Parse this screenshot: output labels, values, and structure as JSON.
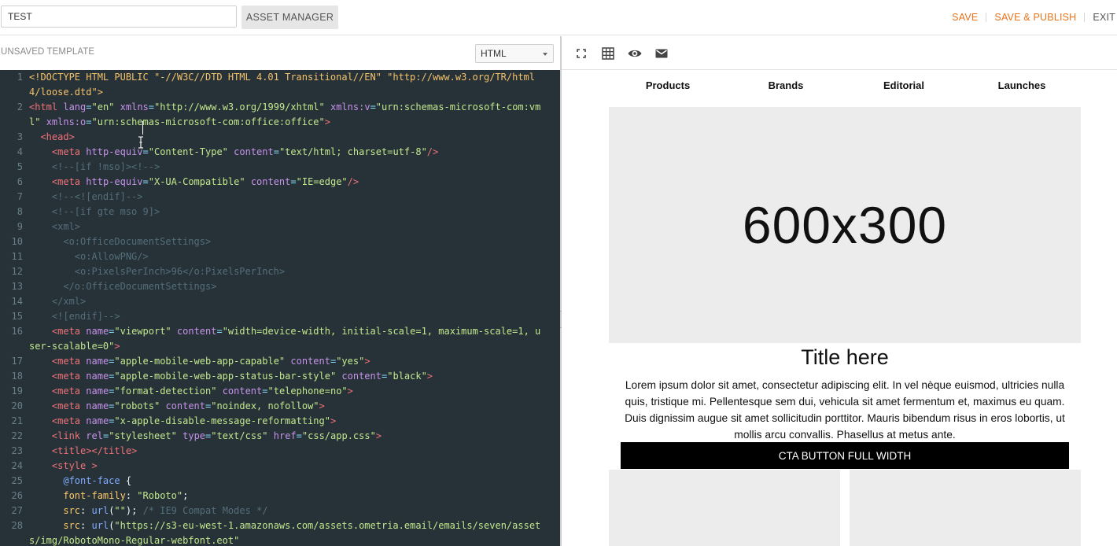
{
  "topbar": {
    "template_name_value": "TEST",
    "asset_manager_label": "ASSET MANAGER",
    "save_label": "SAVE",
    "save_publish_label": "SAVE & PUBLISH",
    "exit_label": "EXIT",
    "accent_color": "#e8731c"
  },
  "editor_header": {
    "status": "UNSAVED TEMPLATE",
    "language_selected": "HTML"
  },
  "preview_toolbar": {
    "icons": [
      "fullscreen-icon",
      "grid-icon",
      "eye-icon",
      "envelope-icon"
    ]
  },
  "code": {
    "background": "#263238",
    "lines": [
      {
        "n": "1",
        "segs": [
          [
            "doc",
            "<!DOCTYPE HTML PUBLIC \"-//W3C//DTD HTML 4.01 Transitional//EN\" \"http://www.w3.org/TR/html4/loose.dtd\">"
          ]
        ]
      },
      {
        "n": "2",
        "segs": [
          [
            "tag",
            "<html "
          ],
          [
            "attr",
            "lang"
          ],
          [
            "eq",
            "="
          ],
          [
            "str",
            "\"en\""
          ],
          [
            "plain",
            " "
          ],
          [
            "attr",
            "xmlns"
          ],
          [
            "eq",
            "="
          ],
          [
            "str",
            "\"http://www.w3.org/1999/xhtml\""
          ],
          [
            "plain",
            " "
          ],
          [
            "attr",
            "xmlns:v"
          ],
          [
            "eq",
            "="
          ],
          [
            "str",
            "\"urn:schemas-microsoft-com:vml\""
          ],
          [
            "plain",
            " "
          ],
          [
            "attr",
            "xmlns:o"
          ],
          [
            "eq",
            "="
          ],
          [
            "str",
            "\"urn:schemas-microsoft-com:office:office\""
          ],
          [
            "tag",
            ">"
          ]
        ]
      },
      {
        "n": "3",
        "segs": [
          [
            "plain",
            "  "
          ],
          [
            "tag",
            "<head>"
          ]
        ]
      },
      {
        "n": "4",
        "segs": [
          [
            "plain",
            "    "
          ],
          [
            "tag",
            "<meta "
          ],
          [
            "attr",
            "http-equiv"
          ],
          [
            "eq",
            "="
          ],
          [
            "str",
            "\"Content-Type\""
          ],
          [
            "plain",
            " "
          ],
          [
            "attr",
            "content"
          ],
          [
            "eq",
            "="
          ],
          [
            "str",
            "\"text/html; charset=utf-8\""
          ],
          [
            "tag",
            "/>"
          ]
        ]
      },
      {
        "n": "5",
        "segs": [
          [
            "plain",
            "    "
          ],
          [
            "cm",
            "<!--[if !mso]><!-->"
          ]
        ]
      },
      {
        "n": "6",
        "segs": [
          [
            "plain",
            "    "
          ],
          [
            "tag",
            "<meta "
          ],
          [
            "attr",
            "http-equiv"
          ],
          [
            "eq",
            "="
          ],
          [
            "str",
            "\"X-UA-Compatible\""
          ],
          [
            "plain",
            " "
          ],
          [
            "attr",
            "content"
          ],
          [
            "eq",
            "="
          ],
          [
            "str",
            "\"IE=edge\""
          ],
          [
            "tag",
            "/>"
          ]
        ]
      },
      {
        "n": "7",
        "segs": [
          [
            "plain",
            "    "
          ],
          [
            "cm",
            "<!--<![endif]-->"
          ]
        ]
      },
      {
        "n": "8",
        "segs": [
          [
            "plain",
            "    "
          ],
          [
            "cm",
            "<!--[if gte mso 9]>"
          ]
        ]
      },
      {
        "n": "9",
        "segs": [
          [
            "plain",
            "    "
          ],
          [
            "cm",
            "<xml>"
          ]
        ]
      },
      {
        "n": "10",
        "segs": [
          [
            "plain",
            "      "
          ],
          [
            "cm",
            "<o:OfficeDocumentSettings>"
          ]
        ]
      },
      {
        "n": "11",
        "segs": [
          [
            "plain",
            "        "
          ],
          [
            "cm",
            "<o:AllowPNG/>"
          ]
        ]
      },
      {
        "n": "12",
        "segs": [
          [
            "plain",
            "        "
          ],
          [
            "cm",
            "<o:PixelsPerInch>96</o:PixelsPerInch>"
          ]
        ]
      },
      {
        "n": "13",
        "segs": [
          [
            "plain",
            "      "
          ],
          [
            "cm",
            "</o:OfficeDocumentSettings>"
          ]
        ]
      },
      {
        "n": "14",
        "segs": [
          [
            "plain",
            "    "
          ],
          [
            "cm",
            "</xml>"
          ]
        ]
      },
      {
        "n": "15",
        "segs": [
          [
            "plain",
            "    "
          ],
          [
            "cm",
            "<![endif]-->"
          ]
        ]
      },
      {
        "n": "16",
        "segs": [
          [
            "plain",
            "    "
          ],
          [
            "tag",
            "<meta "
          ],
          [
            "attr",
            "name"
          ],
          [
            "eq",
            "="
          ],
          [
            "str",
            "\"viewport\""
          ],
          [
            "plain",
            " "
          ],
          [
            "attr",
            "content"
          ],
          [
            "eq",
            "="
          ],
          [
            "str",
            "\"width=device-width, initial-scale=1, maximum-scale=1, user-scalable=0\""
          ],
          [
            "tag",
            ">"
          ]
        ]
      },
      {
        "n": "17",
        "segs": [
          [
            "plain",
            "    "
          ],
          [
            "tag",
            "<meta "
          ],
          [
            "attr",
            "name"
          ],
          [
            "eq",
            "="
          ],
          [
            "str",
            "\"apple-mobile-web-app-capable\""
          ],
          [
            "plain",
            " "
          ],
          [
            "attr",
            "content"
          ],
          [
            "eq",
            "="
          ],
          [
            "str",
            "\"yes\""
          ],
          [
            "tag",
            ">"
          ]
        ]
      },
      {
        "n": "18",
        "segs": [
          [
            "plain",
            "    "
          ],
          [
            "tag",
            "<meta "
          ],
          [
            "attr",
            "name"
          ],
          [
            "eq",
            "="
          ],
          [
            "str",
            "\"apple-mobile-web-app-status-bar-style\""
          ],
          [
            "plain",
            " "
          ],
          [
            "attr",
            "content"
          ],
          [
            "eq",
            "="
          ],
          [
            "str",
            "\"black\""
          ],
          [
            "tag",
            ">"
          ]
        ]
      },
      {
        "n": "19",
        "segs": [
          [
            "plain",
            "    "
          ],
          [
            "tag",
            "<meta "
          ],
          [
            "attr",
            "name"
          ],
          [
            "eq",
            "="
          ],
          [
            "str",
            "\"format-detection\""
          ],
          [
            "plain",
            " "
          ],
          [
            "attr",
            "content"
          ],
          [
            "eq",
            "="
          ],
          [
            "str",
            "\"telephone=no\""
          ],
          [
            "tag",
            ">"
          ]
        ]
      },
      {
        "n": "20",
        "segs": [
          [
            "plain",
            "    "
          ],
          [
            "tag",
            "<meta "
          ],
          [
            "attr",
            "name"
          ],
          [
            "eq",
            "="
          ],
          [
            "str",
            "\"robots\""
          ],
          [
            "plain",
            " "
          ],
          [
            "attr",
            "content"
          ],
          [
            "eq",
            "="
          ],
          [
            "str",
            "\"noindex, nofollow\""
          ],
          [
            "tag",
            ">"
          ]
        ]
      },
      {
        "n": "21",
        "segs": [
          [
            "plain",
            "    "
          ],
          [
            "tag",
            "<meta "
          ],
          [
            "attr",
            "name"
          ],
          [
            "eq",
            "="
          ],
          [
            "str",
            "\"x-apple-disable-message-reformatting\""
          ],
          [
            "tag",
            ">"
          ]
        ]
      },
      {
        "n": "22",
        "segs": [
          [
            "plain",
            "    "
          ],
          [
            "tag",
            "<link "
          ],
          [
            "attr",
            "rel"
          ],
          [
            "eq",
            "="
          ],
          [
            "str",
            "\"stylesheet\""
          ],
          [
            "plain",
            " "
          ],
          [
            "attr",
            "type"
          ],
          [
            "eq",
            "="
          ],
          [
            "str",
            "\"text/css\""
          ],
          [
            "plain",
            " "
          ],
          [
            "attr",
            "href"
          ],
          [
            "eq",
            "="
          ],
          [
            "str",
            "\"css/app.css\""
          ],
          [
            "tag",
            ">"
          ]
        ]
      },
      {
        "n": "23",
        "segs": [
          [
            "plain",
            "    "
          ],
          [
            "tag",
            "<title></title>"
          ]
        ]
      },
      {
        "n": "24",
        "segs": [
          [
            "plain",
            "    "
          ],
          [
            "tag",
            "<style >"
          ]
        ]
      },
      {
        "n": "25",
        "segs": [
          [
            "plain",
            "      "
          ],
          [
            "at",
            "@font-face"
          ],
          [
            "plain",
            " {"
          ]
        ]
      },
      {
        "n": "26",
        "segs": [
          [
            "plain",
            "      "
          ],
          [
            "prop",
            "font-family"
          ],
          [
            "plain",
            ": "
          ],
          [
            "str",
            "\"Roboto\""
          ],
          [
            "plain",
            ";"
          ]
        ]
      },
      {
        "n": "27",
        "segs": [
          [
            "plain",
            "      "
          ],
          [
            "prop",
            "src"
          ],
          [
            "plain",
            ": "
          ],
          [
            "at",
            "url"
          ],
          [
            "plain",
            "("
          ],
          [
            "str",
            "\"\""
          ],
          [
            "plain",
            "); "
          ],
          [
            "cm",
            "/* IE9 Compat Modes */"
          ]
        ]
      },
      {
        "n": "28",
        "segs": [
          [
            "plain",
            "      "
          ],
          [
            "prop",
            "src"
          ],
          [
            "plain",
            ": "
          ],
          [
            "at",
            "url"
          ],
          [
            "plain",
            "("
          ],
          [
            "str",
            "\"https://s3-eu-west-1.amazonaws.com/assets.ometria.email/emails/seven/assets/img/RobotoMono-Regular-webfont.eot\""
          ]
        ]
      }
    ]
  },
  "preview": {
    "nav": [
      "Products",
      "Brands",
      "Editorial",
      "Launches"
    ],
    "hero_placeholder": "600x300",
    "title": "Title here",
    "body": "Lorem ipsum dolor sit amet, consectetur adipiscing elit. In vel nèque euismod, ultricies nulla quis, tristique mi. Pellentesque sem dui, vehicula sit amet fermentum et, maximus eu quam. Duis dignissim augue sit amet sollicitudin porttitor. Mauris bibendum risus in eros lobortis, ut mollis arcu convallis. Phasellus at metus ante.",
    "cta_label": "CTA BUTTON FULL WIDTH"
  }
}
